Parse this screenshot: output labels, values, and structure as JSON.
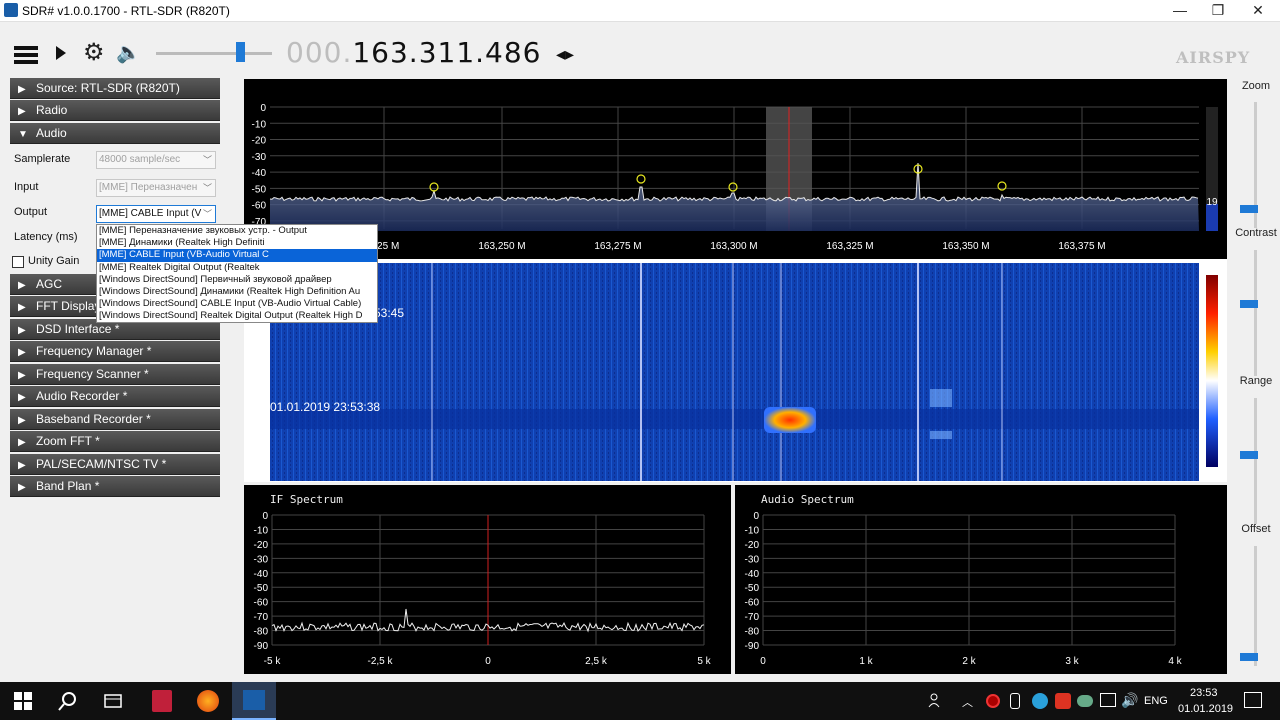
{
  "window": {
    "title": "SDR# v1.0.0.1700 - RTL-SDR (R820T)",
    "minimize": "—",
    "maximize": "❐",
    "close": "✕"
  },
  "toolbar": {
    "freq_dim": "000.",
    "freq_main": "163.311.486",
    "freq_arrows": "◂▸",
    "logo": "AIRSPY",
    "volume_level": 0.69
  },
  "sidebar": {
    "sections": [
      {
        "label": "Source: RTL-SDR (R820T)",
        "expanded": false
      },
      {
        "label": "Radio",
        "expanded": false
      },
      {
        "label": "Audio",
        "expanded": true
      },
      {
        "label": "AGC",
        "expanded": false
      },
      {
        "label": "FFT Display",
        "expanded": false
      },
      {
        "label": "DSD Interface *",
        "expanded": false
      },
      {
        "label": "Frequency Manager *",
        "expanded": false
      },
      {
        "label": "Frequency Scanner *",
        "expanded": false
      },
      {
        "label": "Audio Recorder *",
        "expanded": false
      },
      {
        "label": "Baseband Recorder *",
        "expanded": false
      },
      {
        "label": "Zoom FFT *",
        "expanded": false
      },
      {
        "label": "PAL/SECAM/NTSC TV *",
        "expanded": false
      },
      {
        "label": "Band Plan *",
        "expanded": false
      }
    ],
    "audio": {
      "samplerate_label": "Samplerate",
      "samplerate_value": "48000 sample/sec",
      "input_label": "Input",
      "input_value": "[MME] Переназначен",
      "output_label": "Output",
      "output_value": "[MME] CABLE Input (V",
      "latency_label": "Latency (ms)",
      "unity_gain_label": "Unity Gain"
    },
    "dropdown_options": [
      "[MME] Переназначение звуковых устр. - Output",
      "[MME] Динамики (Realtek High Definiti",
      "[MME] CABLE Input (VB-Audio Virtual C",
      "[MME] Realtek Digital Output (Realtek",
      "[Windows DirectSound] Первичный звуковой драйвер",
      "[Windows DirectSound] Динамики (Realtek High Definition Au",
      "[Windows DirectSound] CABLE Input (VB-Audio Virtual Cable)",
      "[Windows DirectSound] Realtek Digital Output (Realtek High D"
    ],
    "dropdown_selected": 2
  },
  "spectrum": {
    "y_ticks": [
      "0",
      "-10",
      "-20",
      "-30",
      "-40",
      "-50",
      "-60",
      "-70"
    ],
    "x_ticks": [
      ".225 M",
      "163,250 M",
      "163,275 M",
      "163,300 M",
      "163,325 M",
      "163,350 M",
      "163,375 M"
    ],
    "level_readout": "19",
    "timestamp1": "53:45",
    "timestamp2": "01.01.2019 23:53:38"
  },
  "if_spectrum": {
    "title": "IF Spectrum",
    "y_ticks": [
      "0",
      "-10",
      "-20",
      "-30",
      "-40",
      "-50",
      "-60",
      "-70",
      "-80",
      "-90"
    ],
    "x_ticks": [
      "-5 k",
      "-2,5 k",
      "0",
      "2,5 k",
      "5 k"
    ]
  },
  "audio_spectrum": {
    "title": "Audio Spectrum",
    "y_ticks": [
      "0",
      "-10",
      "-20",
      "-30",
      "-40",
      "-50",
      "-60",
      "-70",
      "-80",
      "-90"
    ],
    "x_ticks": [
      "0",
      "1 k",
      "2 k",
      "3 k",
      "4 k"
    ]
  },
  "right_controls": {
    "zoom": "Zoom",
    "contrast": "Contrast",
    "range": "Range",
    "offset": "Offset"
  },
  "taskbar": {
    "lang": "ENG",
    "time": "23:53",
    "date": "01.01.2019"
  }
}
